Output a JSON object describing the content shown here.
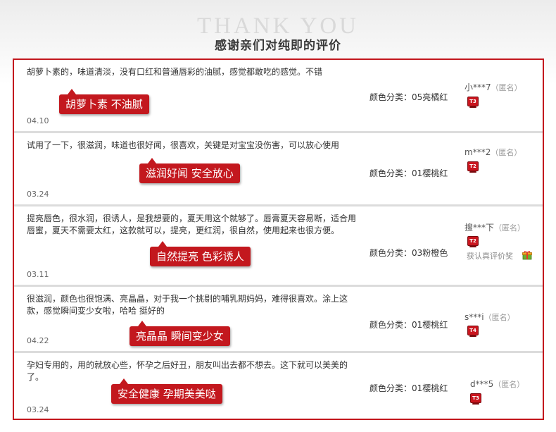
{
  "header": {
    "title": "THANK YOU",
    "subtitle": "感谢亲们对纯即的评价"
  },
  "colors": {
    "accent": "#c3181e",
    "divider": "#dcdcdc"
  },
  "reviews": [
    {
      "text": "胡萝卜素的，味道清淡，没有口红和普通唇彩的油腻，感觉都敢吃的感觉。不错",
      "tag": "胡萝卜素 不油腻",
      "date": "04.10",
      "sku": "颜色分类：05亮橘红",
      "user": "小***7",
      "anon": "（匿名）",
      "level": "T3"
    },
    {
      "text": "试用了一下，很滋润，味道也很好闻，很喜欢，关键是对宝宝没伤害，可以放心使用",
      "tag": "滋润好闻 安全放心",
      "date": "03.24",
      "sku": "颜色分类：01樱桃红",
      "user": "m***2",
      "anon": "（匿名）",
      "level": "T2"
    },
    {
      "text": "提亮唇色，很水润，很诱人，是我想要的，夏天用这个就够了。唇膏夏天容易断，适合用唇蜜，夏天不需要太红，这款就可以，提亮，更红润，很自然，使用起来也很方便。",
      "tag": "自然提亮 色彩诱人",
      "date": "03.11",
      "sku": "颜色分类：03粉橙色",
      "user": "搜***下",
      "anon": "（匿名）",
      "level": "T2",
      "award": "获认真评价奖"
    },
    {
      "text": "很滋润，颜色也很饱满、亮晶晶，对于我一个挑剔的哺乳期妈妈，难得很喜欢。涂上这款，感觉瞬间变少女啦，哈哈 挺好的",
      "tag": "亮晶晶 瞬间变少女",
      "date": "04.22",
      "sku": "颜色分类：01樱桃红",
      "user": "s***i",
      "anon": "（匿名）",
      "level": "T4"
    },
    {
      "text": "孕妇专用的，用的就放心些，怀孕之后好丑，朋友叫出去都不想去。这下就可以美美的了。",
      "tag": "安全健康 孕期美美哒",
      "date": "03.24",
      "sku": "颜色分类：01樱桃红",
      "user": "d***5",
      "anon": "（匿名）",
      "level": "T3"
    }
  ]
}
